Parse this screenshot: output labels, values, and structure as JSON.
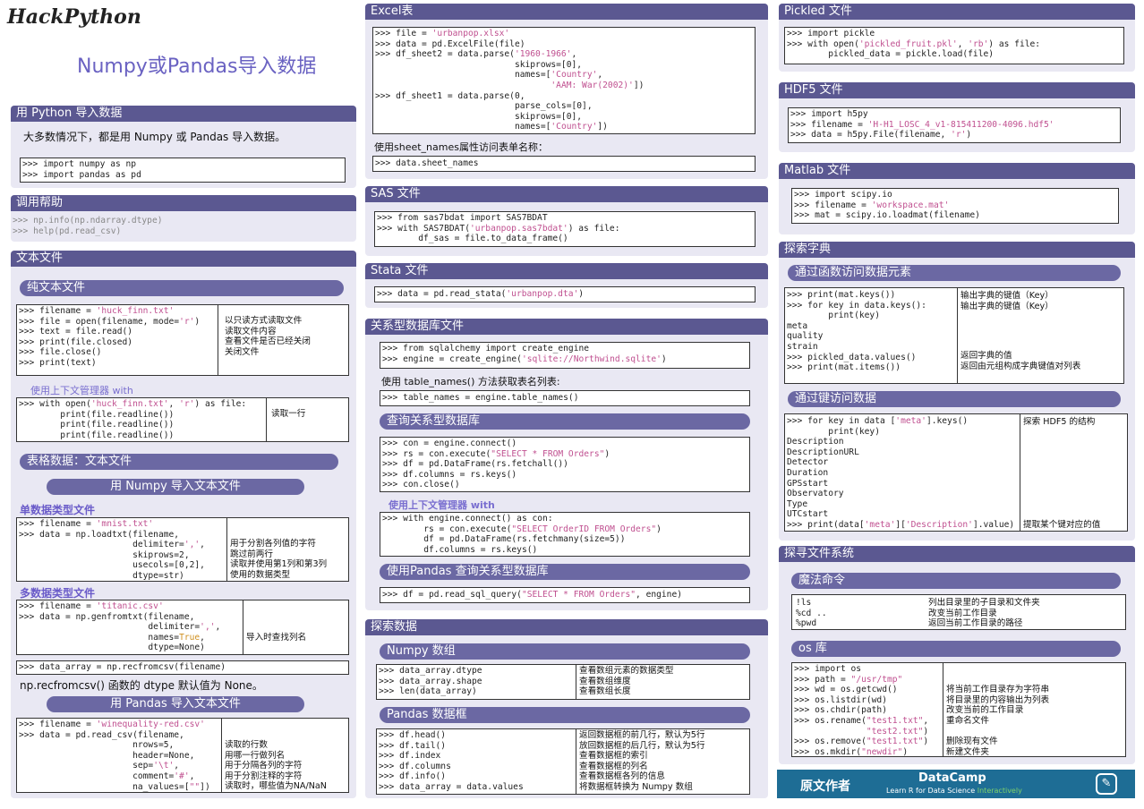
{
  "brand": "HackPython",
  "title": "Numpy或Pandas导入数据",
  "python": {
    "header": "用 Python 导入数据",
    "intro": "大多数情况下，都是用 Numpy 或 Pandas 导入数据。",
    "code": ">>> import numpy as np\n>>> import pandas as pd"
  },
  "help": {
    "header": "调用帮助",
    "code": ">>> np.info(np.ndarray.dtype)\n>>> help(pd.read_csv)"
  },
  "text": {
    "header": "文本文件",
    "plain": "纯文本文件",
    "plain_code": ">>> filename = 'huck_finn.txt'\n>>> file = open(filename, mode='r')\n>>> text = file.read()\n>>> print(file.closed)\n>>> file.close()\n>>> print(text)",
    "plain_desc": "以只读方式读取文件\n读取文件内容\n查看文件是否已经关闭\n关闭文件",
    "ctx_label": "使用上下文管理器 with",
    "ctx_code": ">>> with open('huck_finn.txt', 'r') as file:\n        print(file.readline())\n        print(file.readline())\n        print(file.readline())",
    "ctx_desc": "读取一行",
    "table": "表格数据：文本文件",
    "np_import": "用 Numpy 导入文本文件",
    "single": "单数据类型文件",
    "single_code": ">>> filename = 'mnist.txt'\n>>> data = np.loadtxt(filename,\n                      delimiter=',',\n                      skiprows=2,\n                      usecols=[0,2],\n                      dtype=str)",
    "single_desc": "用于分割各列值的字符\n跳过前两行\n读取并使用第1列和第3列\n使用的数据类型",
    "multi": "多数据类型文件",
    "multi_code": ">>> filename = 'titanic.csv'\n>>> data = np.genfromtxt(filename,\n                         delimiter=',',\n                         names=True,\n                         dtype=None)",
    "multi_desc": "导入时查找列名",
    "rec_code": ">>> data_array = np.recfromcsv(filename)",
    "rec_note": "np.recfromcsv() 函数的 dtype 默认值为 None。",
    "pd_import": "用 Pandas 导入文本文件",
    "pd_code": ">>> filename = 'winequality-red.csv'\n>>> data = pd.read_csv(filename,\n                      nrows=5,\n                      header=None,\n                      sep='\\t',\n                      comment='#',\n                      na_values=[\"\"])",
    "pd_desc": "读取的行数\n用哪一行做列名\n用于分隔各列的字符\n用于分割注释的字符\n读取时，哪些值为NA/NaN"
  },
  "excel": {
    "header": "Excel表",
    "code": ">>> file = 'urbanpop.xlsx'\n>>> data = pd.ExcelFile(file)\n>>> df_sheet2 = data.parse('1960-1966',\n                           skiprows=[0],\n                           names=['Country',\n                                  'AAM: War(2002)'])\n>>> df_sheet1 = data.parse(0,\n                           parse_cols=[0],\n                           skiprows=[0],\n                           names=['Country'])",
    "note": "使用sheet_names属性访问表单名称：",
    "code2": ">>> data.sheet_names"
  },
  "sas": {
    "header": "SAS 文件",
    "code": ">>> from sas7bdat import SAS7BDAT\n>>> with SAS7BDAT('urbanpop.sas7bdat') as file:\n        df_sas = file.to_data_frame()"
  },
  "stata": {
    "header": "Stata 文件",
    "code": ">>> data = pd.read_stata('urbanpop.dta')"
  },
  "rel": {
    "header": "关系型数据库文件",
    "code": ">>> from sqlalchemy import create_engine\n>>> engine = create_engine('sqlite://Northwind.sqlite')",
    "note": "使用 table_names() 方法获取表名列表:",
    "code2": ">>> table_names = engine.table_names()",
    "query": "查询关系型数据库",
    "query_code": ">>> con = engine.connect()\n>>> rs = con.execute(\"SELECT * FROM Orders\")\n>>> df = pd.DataFrame(rs.fetchall())\n>>> df.columns = rs.keys()\n>>> con.close()",
    "ctx": "使用上下文管理器 with",
    "ctx_code": ">>> with engine.connect() as con:\n        rs = con.execute(\"SELECT OrderID FROM Orders\")\n        df = pd.DataFrame(rs.fetchmany(size=5))\n        df.columns = rs.keys()",
    "pd": "使用Pandas 查询关系型数据库",
    "pd_code": ">>> df = pd.read_sql_query(\"SELECT * FROM Orders\", engine)"
  },
  "explore": {
    "header": "探索数据",
    "numpy": "Numpy 数组",
    "np_code": ">>> data_array.dtype\n>>> data_array.shape\n>>> len(data_array)",
    "np_desc": "查看数组元素的数据类型\n查看数组维度\n查看数组长度",
    "pandas": "Pandas 数据框",
    "pd_code": ">>> df.head()\n>>> df.tail()\n>>> df.index\n>>> df.columns\n>>> df.info()\n>>> data_array = data.values",
    "pd_desc": "返回数据框的前几行，默认为5行\n放回数据框的后几行，默认为5行\n查看数据框的索引\n查看数据框的列名\n查看数据框各列的信息\n将数据框转换为 Numpy 数组"
  },
  "pickle": {
    "header": "Pickled 文件",
    "code": ">>> import pickle\n>>> with open('pickled_fruit.pkl', 'rb') as file:\n        pickled_data = pickle.load(file)"
  },
  "hdf5": {
    "header": "HDF5 文件",
    "code": ">>> import h5py\n>>> filename = 'H-H1_LOSC_4_v1-815411200-4096.hdf5'\n>>> data = h5py.File(filename, 'r')"
  },
  "matlab": {
    "header": "Matlab 文件",
    "code": ">>> import scipy.io\n>>> filename = 'workspace.mat'\n>>> mat = scipy.io.loadmat(filename)"
  },
  "dict": {
    "header": "探索字典",
    "func": "通过函数访问数据元素",
    "func_code": ">>> print(mat.keys())\n>>> for key in data.keys():\n        print(key)\nmeta\nquality\nstrain\n>>> pickled_data.values()\n>>> print(mat.items())",
    "func_desc1": "输出字典的键值（Key）\n输出字典的键值（Key）",
    "func_desc2": "返回字典的值\n返回由元组构成字典键值对列表",
    "key": "通过键访问数据",
    "key_code": ">>> for key in data ['meta'].keys()\n        print(key)\nDescription\nDescriptionURL\nDetector\nDuration\nGPSstart\nObservatory\nType\nUTCstart\n>>> print(data['meta']['Description'].value)",
    "key_desc1": "探索 HDF5 的结构",
    "key_desc2": "提取某个键对应的值"
  },
  "fs": {
    "header": "探寻文件系统",
    "magic": "魔法命令",
    "magic_code": "!ls\n%cd ..\n%pwd",
    "magic_desc": "列出目录里的子目录和文件夹\n改变当前工作目录\n返回当前工作目录的路径",
    "os": "os 库",
    "os_code": ">>> import os\n>>> path = \"/usr/tmp\"\n>>> wd = os.getcwd()\n>>> os.listdir(wd)\n>>> os.chdir(path)\n>>> os.rename(\"test1.txt\",\n              \"test2.txt\")\n>>> os.remove(\"test1.txt\")\n>>> os.mkdir(\"newdir\")",
    "os_desc1": "将当前工作目录存为字符串\n将目录里的内容输出为列表\n改变当前的工作目录\n重命名文件",
    "os_desc2": "删除现有文件\n新建文件夹"
  },
  "footer": {
    "author": "原文作者",
    "company": "DataCamp",
    "tagline": "Learn R for Data Science",
    "tagline2": "Interactively"
  },
  "colors": {
    "header": "#5b5891",
    "accent": "#6a62c2",
    "footer": "#1e6d95"
  }
}
